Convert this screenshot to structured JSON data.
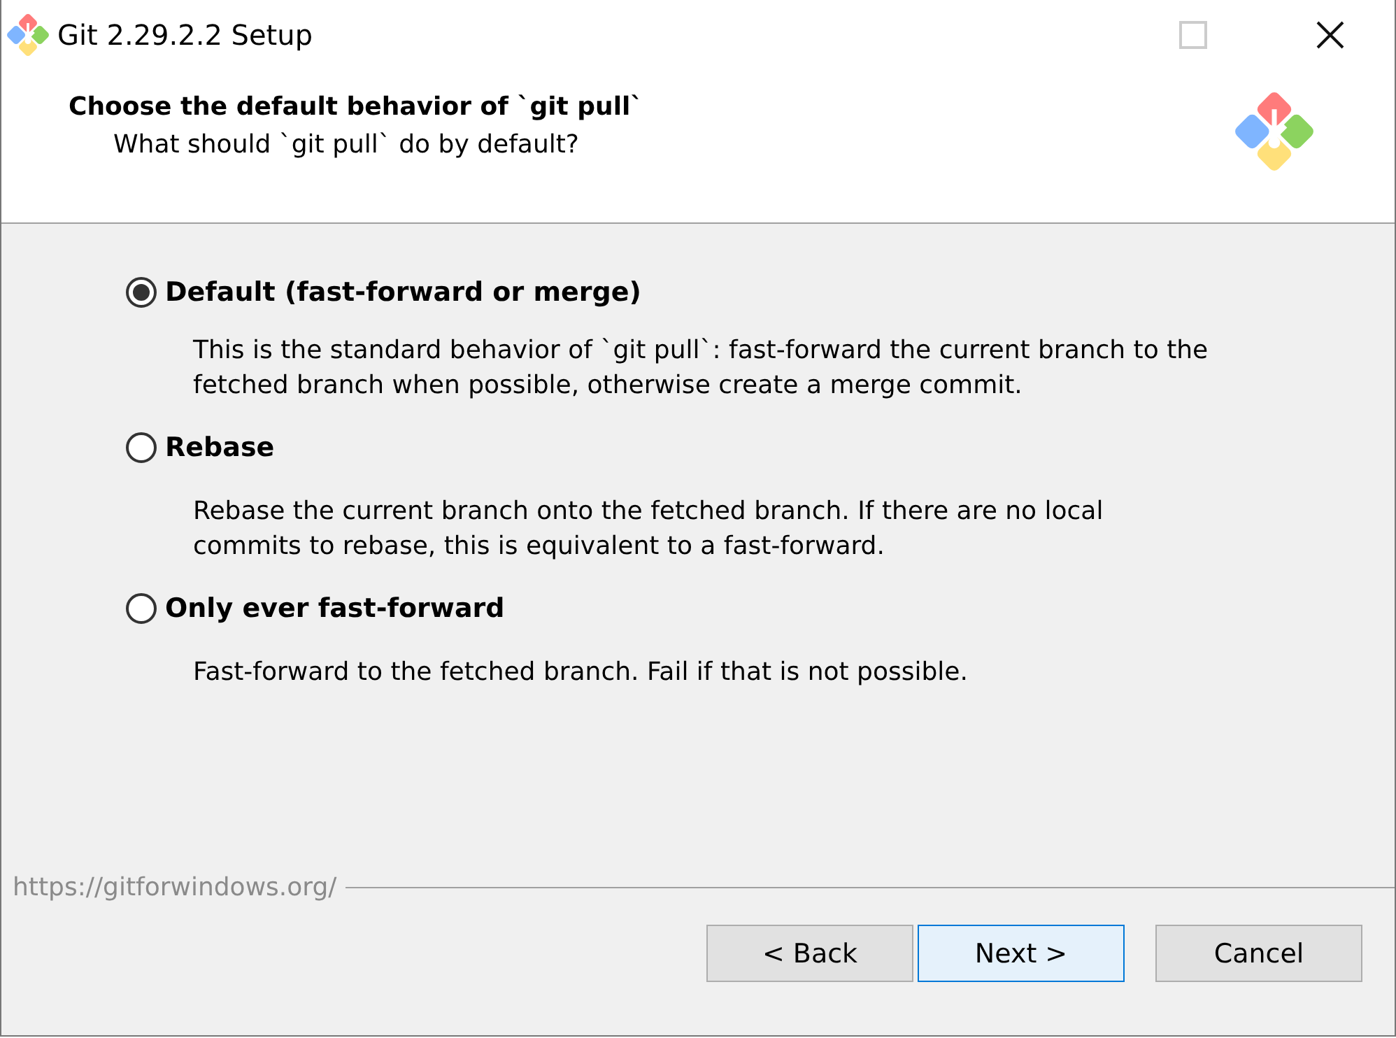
{
  "window": {
    "title": "Git 2.29.2.2 Setup"
  },
  "header": {
    "title": "Choose the default behavior of `git pull`",
    "subtitle": "What should `git pull` do by default?"
  },
  "options": [
    {
      "label": "Default (fast-forward or merge)",
      "selected": true,
      "description": "This is the standard behavior of `git pull`: fast-forward the current branch to the fetched branch when possible, otherwise create a merge commit."
    },
    {
      "label": "Rebase",
      "selected": false,
      "description": "Rebase the current branch onto the fetched branch. If there are no local commits to rebase, this is equivalent to a fast-forward."
    },
    {
      "label": "Only ever fast-forward",
      "selected": false,
      "description": "Fast-forward to the fetched branch. Fail if that is not possible."
    }
  ],
  "footer": {
    "link": "https://gitforwindows.org/"
  },
  "buttons": [
    {
      "label": "< Back",
      "focused": false
    },
    {
      "label": "Next >",
      "focused": true
    },
    {
      "label": "Cancel",
      "focused": false
    }
  ]
}
